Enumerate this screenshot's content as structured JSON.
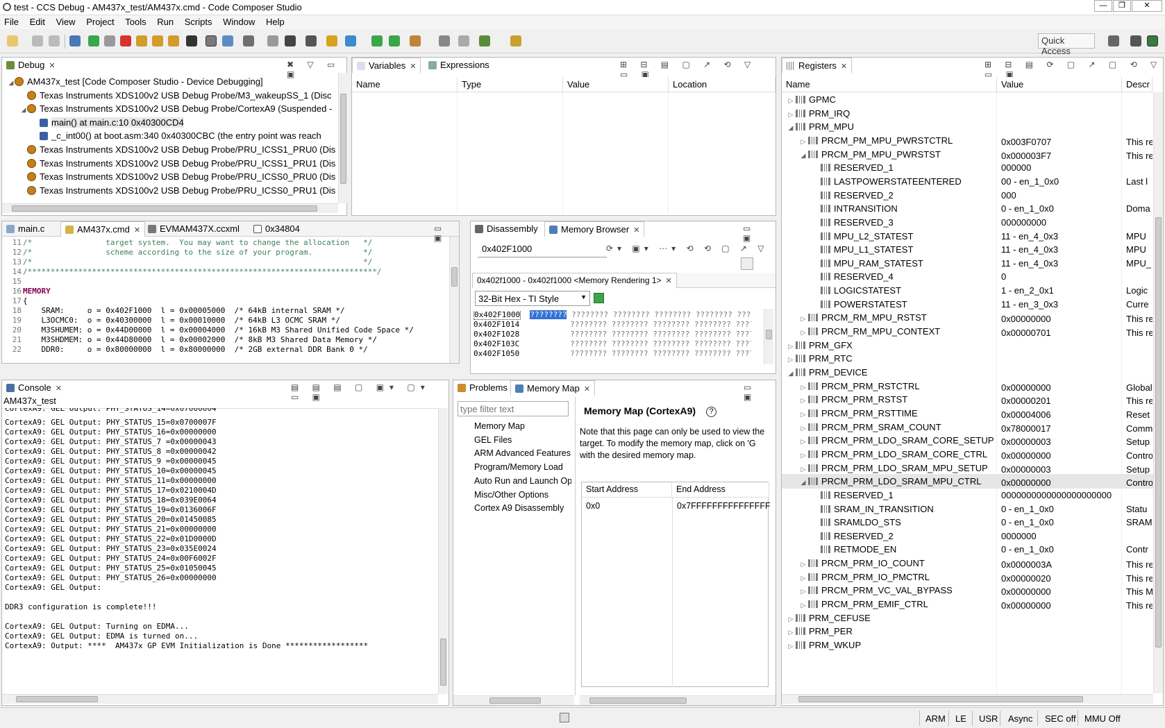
{
  "window": {
    "title": "test - CCS Debug - AM437x_test/AM437x.cmd - Code Composer Studio"
  },
  "menu": [
    "File",
    "Edit",
    "View",
    "Project",
    "Tools",
    "Run",
    "Scripts",
    "Window",
    "Help"
  ],
  "quick_access": "Quick Access",
  "debug": {
    "tab": "Debug",
    "items": [
      {
        "text": "AM437x_test [Code Composer Studio - Device Debugging]",
        "level": 0
      },
      {
        "text": "Texas Instruments XDS100v2 USB Debug Probe/M3_wakeupSS_1 (Disc",
        "level": 1
      },
      {
        "text": "Texas Instruments XDS100v2 USB Debug Probe/CortexA9 (Suspended -",
        "level": 1
      },
      {
        "text": "main() at main.c:10 0x40300CD4",
        "level": 2
      },
      {
        "text": "_c_int00() at boot.asm:340 0x40300CBC  (the entry point was reach",
        "level": 2
      },
      {
        "text": "Texas Instruments XDS100v2 USB Debug Probe/PRU_ICSS1_PRU0 (Dis",
        "level": 1
      },
      {
        "text": "Texas Instruments XDS100v2 USB Debug Probe/PRU_ICSS1_PRU1 (Dis",
        "level": 1
      },
      {
        "text": "Texas Instruments XDS100v2 USB Debug Probe/PRU_ICSS0_PRU0 (Dis",
        "level": 1
      },
      {
        "text": "Texas Instruments XDS100v2 USB Debug Probe/PRU_ICSS0_PRU1 (Dis",
        "level": 1
      }
    ]
  },
  "variables": {
    "tab": "Variables",
    "tab2": "Expressions",
    "cols": [
      "Name",
      "Type",
      "Value",
      "Location"
    ]
  },
  "registers": {
    "tab": "Registers",
    "cols": [
      "Name",
      "Value",
      "Descr"
    ],
    "rows": [
      {
        "name": "GPMC",
        "value": "",
        "desc": "",
        "level": 0,
        "tw": "▷"
      },
      {
        "name": "PRM_IRQ",
        "value": "",
        "desc": "",
        "level": 0,
        "tw": "▷"
      },
      {
        "name": "PRM_MPU",
        "value": "",
        "desc": "",
        "level": 0,
        "tw": "◢"
      },
      {
        "name": "PRCM_PM_MPU_PWRSTCTRL",
        "value": "0x003F0707",
        "desc": "This re",
        "level": 1,
        "tw": "▷"
      },
      {
        "name": "PRCM_PM_MPU_PWRSTST",
        "value": "0x000003F7",
        "desc": "This re",
        "level": 1,
        "tw": "◢"
      },
      {
        "name": "RESERVED_1",
        "value": "000000",
        "desc": "",
        "level": 2,
        "tw": ""
      },
      {
        "name": "LASTPOWERSTATEENTERED",
        "value": "00 - en_1_0x0",
        "desc": "Last l",
        "level": 2,
        "tw": ""
      },
      {
        "name": "RESERVED_2",
        "value": "000",
        "desc": "",
        "level": 2,
        "tw": ""
      },
      {
        "name": "INTRANSITION",
        "value": "0 - en_1_0x0",
        "desc": "Doma",
        "level": 2,
        "tw": ""
      },
      {
        "name": "RESERVED_3",
        "value": "000000000",
        "desc": "",
        "level": 2,
        "tw": ""
      },
      {
        "name": "MPU_L2_STATEST",
        "value": "11 - en_4_0x3",
        "desc": "MPU",
        "level": 2,
        "tw": ""
      },
      {
        "name": "MPU_L1_STATEST",
        "value": "11 - en_4_0x3",
        "desc": "MPU",
        "level": 2,
        "tw": ""
      },
      {
        "name": "MPU_RAM_STATEST",
        "value": "11 - en_4_0x3",
        "desc": "MPU_",
        "level": 2,
        "tw": ""
      },
      {
        "name": "RESERVED_4",
        "value": "0",
        "desc": "",
        "level": 2,
        "tw": ""
      },
      {
        "name": "LOGICSTATEST",
        "value": "1 - en_2_0x1",
        "desc": "Logic",
        "level": 2,
        "tw": ""
      },
      {
        "name": "POWERSTATEST",
        "value": "11 - en_3_0x3",
        "desc": "Curre",
        "level": 2,
        "tw": ""
      },
      {
        "name": "PRCM_RM_MPU_RSTST",
        "value": "0x00000000",
        "desc": "This re",
        "level": 1,
        "tw": "▷"
      },
      {
        "name": "PRCM_RM_MPU_CONTEXT",
        "value": "0x00000701",
        "desc": "This re",
        "level": 1,
        "tw": "▷"
      },
      {
        "name": "PRM_GFX",
        "value": "",
        "desc": "",
        "level": 0,
        "tw": "▷"
      },
      {
        "name": "PRM_RTC",
        "value": "",
        "desc": "",
        "level": 0,
        "tw": "▷"
      },
      {
        "name": "PRM_DEVICE",
        "value": "",
        "desc": "",
        "level": 0,
        "tw": "◢"
      },
      {
        "name": "PRCM_PRM_RSTCTRL",
        "value": "0x00000000",
        "desc": "Global",
        "level": 1,
        "tw": "▷"
      },
      {
        "name": "PRCM_PRM_RSTST",
        "value": "0x00000201",
        "desc": "This re",
        "level": 1,
        "tw": "▷"
      },
      {
        "name": "PRCM_PRM_RSTTIME",
        "value": "0x00004006",
        "desc": "Reset",
        "level": 1,
        "tw": "▷"
      },
      {
        "name": "PRCM_PRM_SRAM_COUNT",
        "value": "0x78000017",
        "desc": "Comm",
        "level": 1,
        "tw": "▷"
      },
      {
        "name": "PRCM_PRM_LDO_SRAM_CORE_SETUP",
        "value": "0x00000003",
        "desc": "Setup",
        "level": 1,
        "tw": "▷"
      },
      {
        "name": "PRCM_PRM_LDO_SRAM_CORE_CTRL",
        "value": "0x00000000",
        "desc": "Contro",
        "level": 1,
        "tw": "▷"
      },
      {
        "name": "PRCM_PRM_LDO_SRAM_MPU_SETUP",
        "value": "0x00000003",
        "desc": "Setup",
        "level": 1,
        "tw": "▷"
      },
      {
        "name": "PRCM_PRM_LDO_SRAM_MPU_CTRL",
        "value": "0x00000000",
        "desc": "Contro",
        "level": 1,
        "tw": "◢",
        "selected": true
      },
      {
        "name": "RESERVED_1",
        "value": "0000000000000000000000",
        "desc": "",
        "level": 2,
        "tw": ""
      },
      {
        "name": "SRAM_IN_TRANSITION",
        "value": "0 - en_1_0x0",
        "desc": "Statu",
        "level": 2,
        "tw": ""
      },
      {
        "name": "SRAMLDO_STS",
        "value": "0 - en_1_0x0",
        "desc": "SRAM",
        "level": 2,
        "tw": ""
      },
      {
        "name": "RESERVED_2",
        "value": "0000000",
        "desc": "",
        "level": 2,
        "tw": ""
      },
      {
        "name": "RETMODE_EN",
        "value": "0 - en_1_0x0",
        "desc": "Contr",
        "level": 2,
        "tw": ""
      },
      {
        "name": "PRCM_PRM_IO_COUNT",
        "value": "0x0000003A",
        "desc": "This re",
        "level": 1,
        "tw": "▷"
      },
      {
        "name": "PRCM_PRM_IO_PMCTRL",
        "value": "0x00000020",
        "desc": "This re",
        "level": 1,
        "tw": "▷"
      },
      {
        "name": "PRCM_PRM_VC_VAL_BYPASS",
        "value": "0x00000000",
        "desc": "This M",
        "level": 1,
        "tw": "▷"
      },
      {
        "name": "PRCM_PRM_EMIF_CTRL",
        "value": "0x00000000",
        "desc": "This re",
        "level": 1,
        "tw": "▷"
      },
      {
        "name": "PRM_CEFUSE",
        "value": "",
        "desc": "",
        "level": 0,
        "tw": "▷"
      },
      {
        "name": "PRM_PER",
        "value": "",
        "desc": "",
        "level": 0,
        "tw": "▷"
      },
      {
        "name": "PRM_WKUP",
        "value": "",
        "desc": "",
        "level": 0,
        "tw": "▷"
      }
    ]
  },
  "editor": {
    "tabs": [
      "main.c",
      "AM437x.cmd",
      "EVMAM437X.ccxml",
      "0x34804"
    ],
    "lines": [
      {
        "n": "11",
        "text": "/*                target system.  You may want to change the allocation   */",
        "cls": "cm"
      },
      {
        "n": "12",
        "text": "/*                scheme according to the size of your program.           */",
        "cls": "cm"
      },
      {
        "n": "13",
        "text": "/*                                                                        */",
        "cls": "cm"
      },
      {
        "n": "14",
        "text": "/****************************************************************************/",
        "cls": "cm"
      },
      {
        "n": "15",
        "text": "",
        "cls": ""
      },
      {
        "n": "16",
        "text": "MEMORY",
        "cls": "kw"
      },
      {
        "n": "17",
        "text": "{",
        "cls": ""
      },
      {
        "n": "18",
        "text": "    SRAM:     o = 0x402F1000  l = 0x00005000  /* 64kB internal SRAM */",
        "cls": ""
      },
      {
        "n": "19",
        "text": "    L3OCMC0:  o = 0x40300000  l = 0x00010000  /* 64kB L3 OCMC SRAM */",
        "cls": ""
      },
      {
        "n": "20",
        "text": "    M3SHUMEM: o = 0x44D00000  l = 0x00004000  /* 16kB M3 Shared Unified Code Space */",
        "cls": ""
      },
      {
        "n": "21",
        "text": "    M3SHDMEM: o = 0x44D80000  l = 0x00002000  /* 8kB M3 Shared Data Memory */",
        "cls": ""
      },
      {
        "n": "22",
        "text": "    DDR0:     o = 0x80000000  l = 0x80000000  /* 2GB external DDR Bank 0 */",
        "cls": ""
      }
    ]
  },
  "memory_browser": {
    "tab1": "Disassembly",
    "tab2": "Memory Browser",
    "address": "0x402F1000",
    "rendering_tab": "0x402f1000 - 0x402f1000 <Memory Rendering 1>",
    "format": "32-Bit Hex - TI Style",
    "rows": [
      {
        "addr": "0x402F1000",
        "first": "????????",
        "rest": " ???????? ???????? ???????? ???????? ????????"
      },
      {
        "addr": "0x402F1014",
        "first": "",
        "rest": " ???????? ???????? ???????? ???????? ????????"
      },
      {
        "addr": "0x402F1028",
        "first": "",
        "rest": " ???????? ???????? ???????? ???????? ????????"
      },
      {
        "addr": "0x402F103C",
        "first": "",
        "rest": " ???????? ???????? ???????? ???????? ????????"
      },
      {
        "addr": "0x402F1050",
        "first": "",
        "rest": " ???????? ???????? ???????? ???????? ????????"
      }
    ]
  },
  "console": {
    "tab": "Console",
    "title": "AM437x_test",
    "lines": [
      "CortexA9: GEL Output: PHY_STATUS_14=0x07000004",
      "CortexA9: GEL Output: PHY_STATUS_15=0x0700007F",
      "CortexA9: GEL Output: PHY_STATUS_16=0x00000000",
      "CortexA9: GEL Output: PHY_STATUS_7 =0x00000043",
      "CortexA9: GEL Output: PHY_STATUS_8 =0x00000042",
      "CortexA9: GEL Output: PHY_STATUS_9 =0x00000045",
      "CortexA9: GEL Output: PHY_STATUS_10=0x00000045",
      "CortexA9: GEL Output: PHY_STATUS_11=0x00000000",
      "CortexA9: GEL Output: PHY_STATUS_17=0x0210004D",
      "CortexA9: GEL Output: PHY_STATUS_18=0x039E0064",
      "CortexA9: GEL Output: PHY_STATUS_19=0x0136006F",
      "CortexA9: GEL Output: PHY_STATUS_20=0x01450085",
      "CortexA9: GEL Output: PHY_STATUS_21=0x00000000",
      "CortexA9: GEL Output: PHY_STATUS_22=0x01D0000D",
      "CortexA9: GEL Output: PHY_STATUS_23=0x035E0024",
      "CortexA9: GEL Output: PHY_STATUS_24=0x00F6002F",
      "CortexA9: GEL Output: PHY_STATUS_25=0x01050045",
      "CortexA9: GEL Output: PHY_STATUS_26=0x00000000",
      "CortexA9: GEL Output:",
      "",
      "DDR3 configuration is complete!!!",
      "",
      "CortexA9: GEL Output: Turning on EDMA...",
      "CortexA9: GEL Output: EDMA is turned on...",
      "CortexA9: Output: ****  AM437x GP EVM Initialization is Done ******************"
    ]
  },
  "memory_map": {
    "tab1": "Problems",
    "tab2": "Memory Map",
    "filter_placeholder": "type filter text",
    "nav": [
      "Memory Map",
      "GEL Files",
      "ARM Advanced Features",
      "Program/Memory Load",
      "Auto Run and Launch Op",
      "Misc/Other Options",
      "Cortex A9 Disassembly"
    ],
    "heading": "Memory Map (CortexA9)",
    "desc1": "Note that this page can only be used to view the",
    "desc2": "target.  To modify the memory map, click on 'G",
    "desc3": "with the desired memory map.",
    "cols": [
      "Start Address",
      "End Address"
    ],
    "rows": [
      {
        "start": "0x0",
        "end": "0x7FFFFFFFFFFFFFFF"
      }
    ]
  },
  "status": [
    "ARM",
    "LE",
    "USR",
    "Async",
    "SEC off",
    "MMU Off"
  ]
}
